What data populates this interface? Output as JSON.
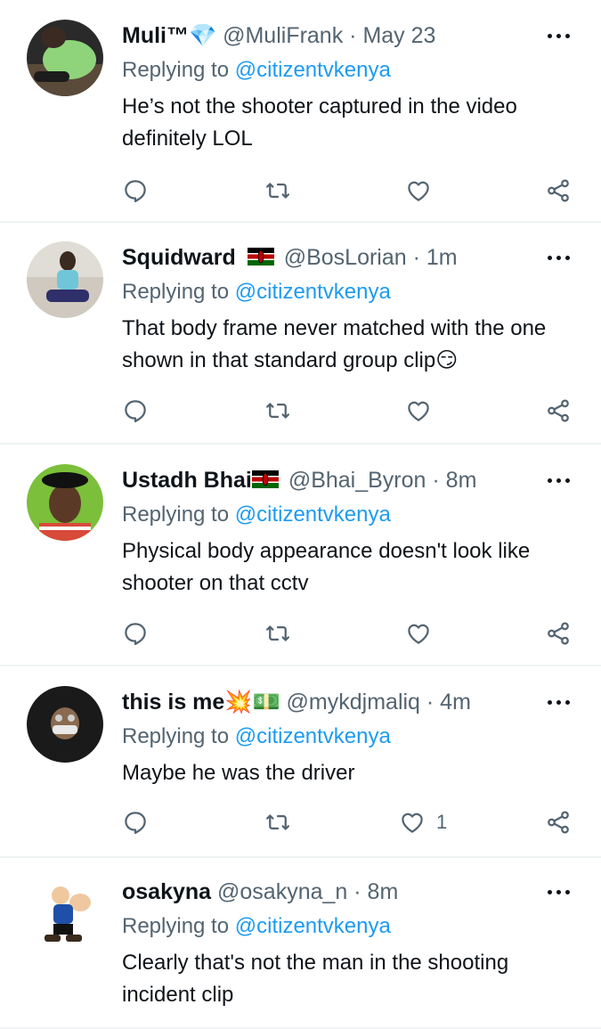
{
  "tweets": [
    {
      "name": "Muli™",
      "name_suffix_emoji": "💎",
      "handle": "@MuliFrank",
      "time": "· May 23",
      "replying_prefix": "Replying to",
      "replying_to": "@citizentvkenya",
      "text": "He’s not the shooter captured in the video definitely LOL",
      "like_count": "",
      "avatar": "man-green-shirt-photo"
    },
    {
      "name": "Squidward",
      "flag": "kenya-flag",
      "handle": "@BosLorian",
      "time": "· 1m",
      "replying_prefix": "Replying to",
      "replying_to": "@citizentvkenya",
      "text": "That body frame never matched with the one shown in that standard group clip",
      "text_emoji": "😏",
      "like_count": "",
      "avatar": "seated-man-photo"
    },
    {
      "name": "Ustadh Bhai",
      "flag": "kenya-flag",
      "handle": "@Bhai_Byron",
      "time": "· 8m",
      "replying_prefix": "Replying to",
      "replying_to": "@citizentvkenya",
      "text": "Physical body appearance doesn't look like shooter on that cctv",
      "like_count": "",
      "avatar": "smiling-man-cap-photo"
    },
    {
      "name": "this is me",
      "name_suffix_emoji": "💥💵",
      "handle": "@mykdjmaliq",
      "time": "· 4m",
      "replying_prefix": "Replying to",
      "replying_to": "@citizentvkenya",
      "text": "Maybe he was the driver",
      "like_count": "1",
      "avatar": "masked-face-dark-photo"
    },
    {
      "name": "osakyna",
      "handle": "@osakyna_n",
      "time": "· 8m",
      "replying_prefix": "Replying to",
      "replying_to": "@citizentvkenya",
      "text": "Clearly that's not the man in the shooting incident clip",
      "like_count": "",
      "avatar": "popeye-cartoon"
    }
  ],
  "icons": {
    "reply": "reply-icon",
    "retweet": "retweet-icon",
    "like": "like-icon",
    "share": "share-icon",
    "more": "more-options-icon"
  },
  "colors": {
    "mention": "#1d9bf0",
    "secondary_text": "#536471",
    "divider": "#eff3f4"
  }
}
